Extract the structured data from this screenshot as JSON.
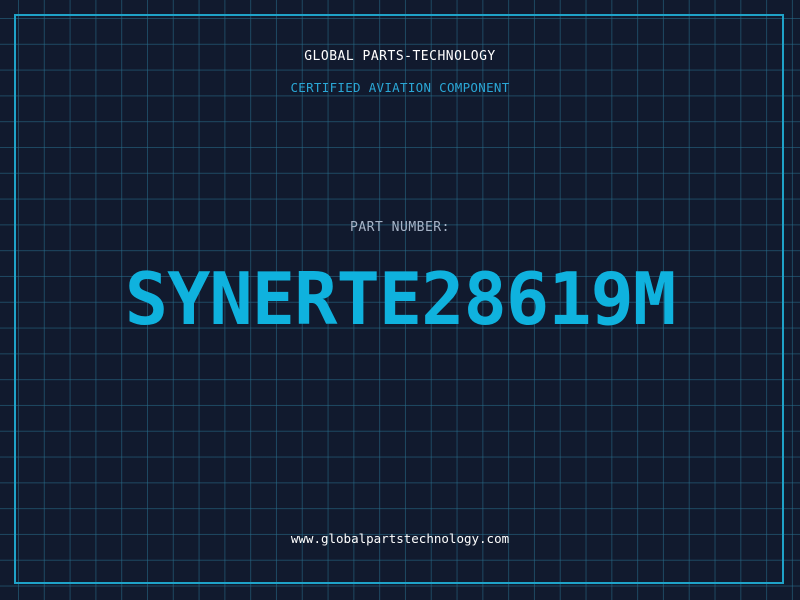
{
  "header": {
    "company_name": "GLOBAL PARTS-TECHNOLOGY",
    "tagline": "CERTIFIED AVIATION COMPONENT"
  },
  "part": {
    "label": "PART NUMBER:",
    "number": "SYNERTE28619M"
  },
  "footer": {
    "website": "www.globalpartstechnology.com"
  },
  "colors": {
    "background": "#111a2e",
    "grid": "#286e8c",
    "frame": "#1fa2c8",
    "accent": "#0fb2de",
    "tagline": "#2aa7d6",
    "label": "#a7b4c7",
    "text": "#ffffff"
  }
}
